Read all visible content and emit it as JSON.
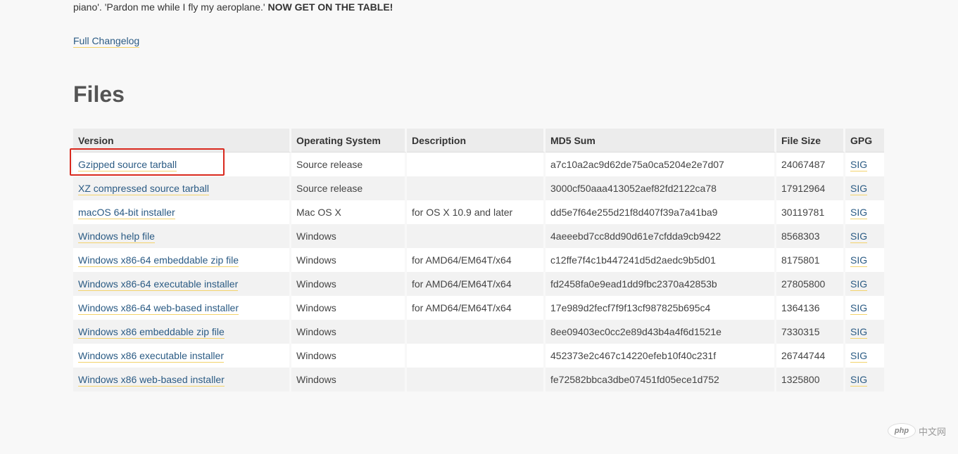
{
  "intro": {
    "text": "piano'. 'Pardon me while I fly my aeroplane.' ",
    "bold": "NOW GET ON THE TABLE!"
  },
  "changelog_link": "Full Changelog",
  "files_heading": "Files",
  "table": {
    "headers": [
      "Version",
      "Operating System",
      "Description",
      "MD5 Sum",
      "File Size",
      "GPG"
    ],
    "rows": [
      {
        "version": "Gzipped source tarball",
        "os": "Source release",
        "description": "",
        "md5": "a7c10a2ac9d62de75a0ca5204e2e7d07",
        "size": "24067487",
        "gpg": "SIG"
      },
      {
        "version": "XZ compressed source tarball",
        "os": "Source release",
        "description": "",
        "md5": "3000cf50aaa413052aef82fd2122ca78",
        "size": "17912964",
        "gpg": "SIG"
      },
      {
        "version": "macOS 64-bit installer",
        "os": "Mac OS X",
        "description": "for OS X 10.9 and later",
        "md5": "dd5e7f64e255d21f8d407f39a7a41ba9",
        "size": "30119781",
        "gpg": "SIG"
      },
      {
        "version": "Windows help file",
        "os": "Windows",
        "description": "",
        "md5": "4aeeebd7cc8dd90d61e7cfdda9cb9422",
        "size": "8568303",
        "gpg": "SIG"
      },
      {
        "version": "Windows x86-64 embeddable zip file",
        "os": "Windows",
        "description": "for AMD64/EM64T/x64",
        "md5": "c12ffe7f4c1b447241d5d2aedc9b5d01",
        "size": "8175801",
        "gpg": "SIG"
      },
      {
        "version": "Windows x86-64 executable installer",
        "os": "Windows",
        "description": "for AMD64/EM64T/x64",
        "md5": "fd2458fa0e9ead1dd9fbc2370a42853b",
        "size": "27805800",
        "gpg": "SIG"
      },
      {
        "version": "Windows x86-64 web-based installer",
        "os": "Windows",
        "description": "for AMD64/EM64T/x64",
        "md5": "17e989d2fecf7f9f13cf987825b695c4",
        "size": "1364136",
        "gpg": "SIG"
      },
      {
        "version": "Windows x86 embeddable zip file",
        "os": "Windows",
        "description": "",
        "md5": "8ee09403ec0cc2e89d43b4a4f6d1521e",
        "size": "7330315",
        "gpg": "SIG"
      },
      {
        "version": "Windows x86 executable installer",
        "os": "Windows",
        "description": "",
        "md5": "452373e2c467c14220efeb10f40c231f",
        "size": "26744744",
        "gpg": "SIG"
      },
      {
        "version": "Windows x86 web-based installer",
        "os": "Windows",
        "description": "",
        "md5": "fe72582bbca3dbe07451fd05ece1d752",
        "size": "1325800",
        "gpg": "SIG"
      }
    ]
  },
  "watermark": {
    "logo_text": "php",
    "text": "中文网"
  },
  "colors": {
    "link": "#2b5b84",
    "link_underline": "#f3d36b",
    "highlight_box": "#d9291e",
    "heading": "#555555"
  }
}
